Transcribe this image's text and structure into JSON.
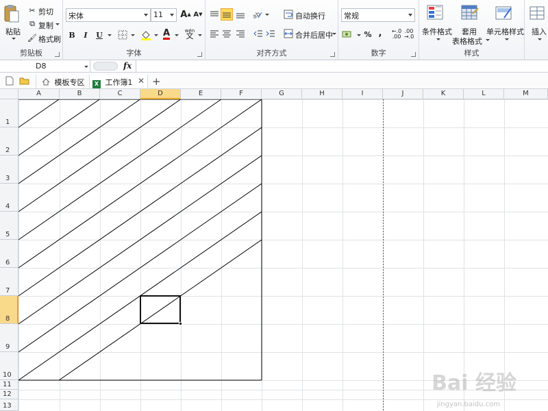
{
  "ribbon": {
    "clipboard": {
      "label": "剪贴板",
      "paste": "粘贴",
      "cut": "剪切",
      "copy": "复制",
      "format_painter": "格式刷"
    },
    "font": {
      "label": "字体",
      "font_name": "宋体",
      "font_size": "11",
      "bold": "B",
      "italic": "I",
      "underline": "U",
      "grow": "A",
      "shrink": "A",
      "font_color": "A",
      "wen": "wén",
      "wen_char": "文"
    },
    "alignment": {
      "label": "对齐方式",
      "wrap_text": "自动换行",
      "merge_center": "合并后居中"
    },
    "number": {
      "label": "数字",
      "format": "常规",
      "percent": "%",
      "comma": ",",
      "inc_decimal": ".0\n.00",
      "dec_decimal": ".00\n→.0"
    },
    "styles": {
      "label": "样式",
      "conditional": "条件格式",
      "table_line1": "套用",
      "table_line2": "表格格式",
      "cell_styles": "单元格样式"
    },
    "cells": {
      "insert": "插入"
    }
  },
  "formula_bar": {
    "name_box": "D8",
    "fx": "fx",
    "formula": ""
  },
  "tabs": {
    "template": "模板专区",
    "workbook": "工作簿1",
    "add": "+"
  },
  "sheet": {
    "columns": [
      "A",
      "B",
      "C",
      "D",
      "E",
      "F",
      "G",
      "H",
      "I",
      "J",
      "K",
      "L",
      "M"
    ],
    "rows": [
      "1",
      "2",
      "3",
      "4",
      "5",
      "6",
      "7",
      "8",
      "9",
      "10",
      "11",
      "12",
      "13"
    ],
    "selected_cell": "D8",
    "selected_column": "D",
    "selected_row": "8"
  },
  "watermark": {
    "text": "Bai 经验",
    "sub": "jingyan.baidu.com"
  },
  "colors": {
    "selection_header": "#f9d98a",
    "header_bg": "#f3f4f6",
    "grid_line": "#dfe2e6"
  }
}
